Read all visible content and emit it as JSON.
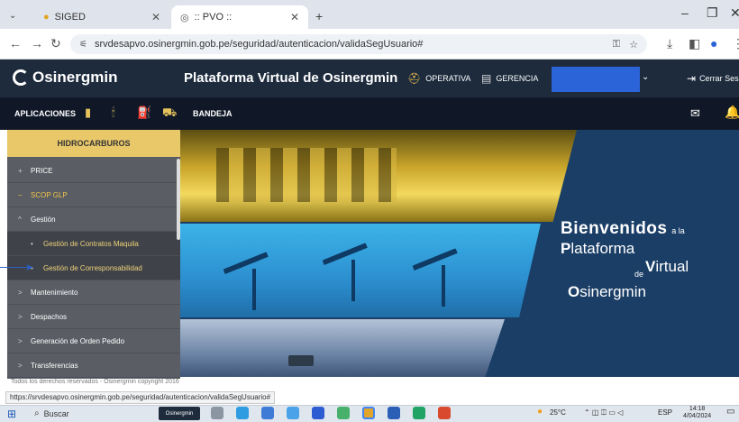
{
  "browser": {
    "tabs": [
      {
        "label": "SIGED",
        "active": false
      },
      {
        "label": ":: PVO ::",
        "active": true
      }
    ],
    "new_tab_label": "+",
    "url": "srvdesapvo.osinergmin.gob.pe/seguridad/autenticacion/validaSegUsuario#",
    "status_url": "https://srvdesapvo.osinergmin.gob.pe/seguridad/autenticacion/validaSegUsuario#"
  },
  "header": {
    "logo": "Osinergmin",
    "title": "Plataforma Virtual de Osinergmin",
    "buttons": [
      "OPERATIVA",
      "GERENCIA"
    ],
    "logout": "Cerrar Sesión"
  },
  "subbar": {
    "apps_label": "APLICACIONES",
    "bandeja": "BANDEJA"
  },
  "sidebar": {
    "header": "HIDROCARBUROS",
    "items": [
      {
        "prefix": "+",
        "label": "PRICE",
        "type": "top"
      },
      {
        "prefix": "−",
        "label": "SCOP GLP",
        "type": "open"
      },
      {
        "prefix": "^",
        "label": "Gestión",
        "type": "top"
      },
      {
        "prefix": "•",
        "label": "Gestión de Contratos Maquila",
        "type": "sub"
      },
      {
        "prefix": "•",
        "label": "Gestión de Corresponsabilidad",
        "type": "sub"
      },
      {
        "prefix": ">",
        "label": "Mantenimiento",
        "type": "top"
      },
      {
        "prefix": ">",
        "label": "Despachos",
        "type": "top"
      },
      {
        "prefix": ">",
        "label": "Generación de Orden Pedido",
        "type": "top"
      },
      {
        "prefix": ">",
        "label": "Transferencias",
        "type": "top"
      }
    ]
  },
  "banner": {
    "line1_big": "Bienvenidos",
    "line1_small": "a la",
    "line2_initial": "P",
    "line2_rest": "lataforma",
    "line3_initial": "V",
    "line3_rest": "irtual",
    "line3_prefix": "de",
    "line4_initial": "O",
    "line4_rest": "sinergmin"
  },
  "footer": {
    "text": "Todos los derechos reservados - Osinergmin copyright 2016"
  },
  "taskbar": {
    "search": "Buscar",
    "osinergmin_app": "Osinergmin",
    "temperature": "25°C",
    "language": "ESP",
    "time": "14:18",
    "date": "4/04/2024"
  },
  "colors": {
    "header_bg": "#1d2b3d",
    "subbar_bg": "#101828",
    "accent_gold": "#e9c86a",
    "user_box": "#2b63d8"
  }
}
